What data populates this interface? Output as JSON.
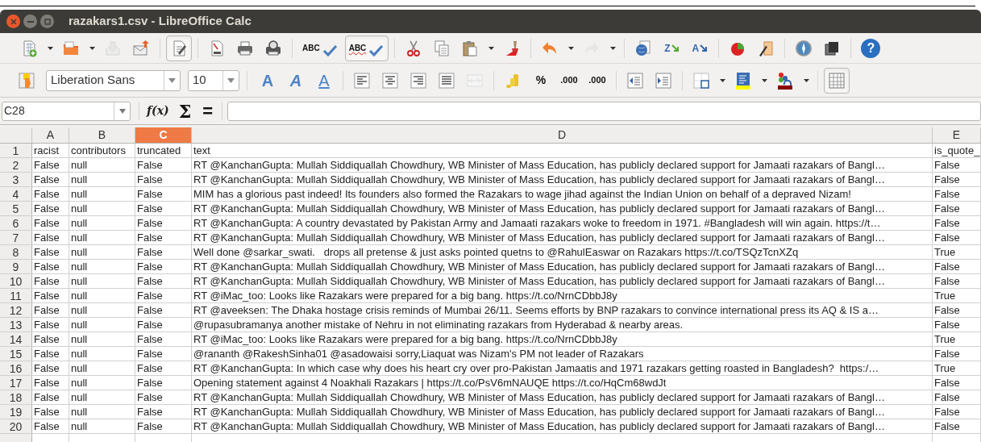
{
  "window": {
    "title": "razakars1.csv - LibreOffice Calc"
  },
  "standard_toolbar": [
    {
      "kind": "new",
      "dropdown": true,
      "pressed": false,
      "disabled": false
    },
    {
      "kind": "open",
      "dropdown": true,
      "pressed": false,
      "disabled": false
    },
    {
      "kind": "save",
      "dropdown": false,
      "pressed": false,
      "disabled": true
    },
    {
      "kind": "email",
      "dropdown": false,
      "pressed": false,
      "disabled": false
    },
    {
      "kind": "sep"
    },
    {
      "kind": "edit",
      "dropdown": false,
      "pressed": true,
      "disabled": false
    },
    {
      "kind": "sep"
    },
    {
      "kind": "pdf",
      "dropdown": false,
      "pressed": false,
      "disabled": false
    },
    {
      "kind": "print",
      "dropdown": false,
      "pressed": false,
      "disabled": false
    },
    {
      "kind": "preview",
      "dropdown": false,
      "pressed": false,
      "disabled": false
    },
    {
      "kind": "sep"
    },
    {
      "kind": "spell",
      "glyph": "ABC",
      "dropdown": false,
      "pressed": false,
      "disabled": false
    },
    {
      "kind": "autospell",
      "glyph": "ABC",
      "dropdown": false,
      "pressed": true,
      "disabled": false
    },
    {
      "kind": "sep"
    },
    {
      "kind": "cut",
      "dropdown": false,
      "pressed": false,
      "disabled": false
    },
    {
      "kind": "copy",
      "dropdown": false,
      "pressed": false,
      "disabled": false
    },
    {
      "kind": "paste",
      "dropdown": true,
      "pressed": false,
      "disabled": false
    },
    {
      "kind": "brush",
      "dropdown": false,
      "pressed": false,
      "disabled": false
    },
    {
      "kind": "sep"
    },
    {
      "kind": "undo",
      "dropdown": true,
      "pressed": false,
      "disabled": false
    },
    {
      "kind": "redo",
      "dropdown": true,
      "pressed": false,
      "disabled": true
    },
    {
      "kind": "sep"
    },
    {
      "kind": "globe",
      "dropdown": false,
      "pressed": false,
      "disabled": false
    },
    {
      "kind": "sort_asc",
      "glyph": "Z",
      "dropdown": false,
      "pressed": false,
      "disabled": false
    },
    {
      "kind": "sort_desc",
      "glyph": "A",
      "dropdown": false,
      "pressed": false,
      "disabled": false
    },
    {
      "kind": "sep"
    },
    {
      "kind": "chart",
      "dropdown": false,
      "pressed": false,
      "disabled": false
    },
    {
      "kind": "draw",
      "dropdown": false,
      "pressed": false,
      "disabled": false
    },
    {
      "kind": "sep"
    },
    {
      "kind": "compass",
      "dropdown": false,
      "pressed": false,
      "disabled": false
    },
    {
      "kind": "gallery",
      "dropdown": false,
      "pressed": false,
      "disabled": false
    },
    {
      "kind": "sep"
    },
    {
      "kind": "help",
      "glyph": "?",
      "dropdown": false,
      "pressed": false,
      "disabled": false
    }
  ],
  "formatting_toolbar": {
    "font_name": "Liberation Sans",
    "font_size": "10",
    "items": [
      {
        "kind": "bold",
        "glyph": "A",
        "dropdown": false,
        "pressed": false,
        "disabled": false
      },
      {
        "kind": "italic",
        "glyph": "A",
        "dropdown": false,
        "pressed": false,
        "disabled": false
      },
      {
        "kind": "underline",
        "glyph": "A",
        "dropdown": false,
        "pressed": false,
        "disabled": false
      },
      {
        "kind": "sep"
      },
      {
        "kind": "align_left",
        "dropdown": false,
        "pressed": false,
        "disabled": false
      },
      {
        "kind": "align_center",
        "dropdown": false,
        "pressed": false,
        "disabled": false
      },
      {
        "kind": "align_right",
        "dropdown": false,
        "pressed": false,
        "disabled": false
      },
      {
        "kind": "justify",
        "dropdown": false,
        "pressed": false,
        "disabled": false
      },
      {
        "kind": "merge",
        "dropdown": false,
        "pressed": false,
        "disabled": true
      },
      {
        "kind": "sep"
      },
      {
        "kind": "currency",
        "dropdown": false,
        "pressed": false,
        "disabled": false
      },
      {
        "kind": "percent",
        "glyph": "%",
        "dropdown": false,
        "pressed": false,
        "disabled": false
      },
      {
        "kind": "add_decimal",
        "glyph": ".000",
        "dropdown": false,
        "pressed": false,
        "disabled": false
      },
      {
        "kind": "delete_decimal",
        "glyph": ".000",
        "dropdown": false,
        "pressed": false,
        "disabled": false
      },
      {
        "kind": "sep"
      },
      {
        "kind": "indent_less",
        "dropdown": false,
        "pressed": false,
        "disabled": false
      },
      {
        "kind": "indent_more",
        "dropdown": false,
        "pressed": false,
        "disabled": false
      },
      {
        "kind": "sep"
      },
      {
        "kind": "borders",
        "dropdown": true,
        "pressed": false,
        "disabled": false
      },
      {
        "kind": "background",
        "dropdown": true,
        "pressed": false,
        "disabled": false
      },
      {
        "kind": "font_color",
        "dropdown": true,
        "pressed": false,
        "disabled": false
      },
      {
        "kind": "sep"
      },
      {
        "kind": "grid",
        "dropdown": false,
        "pressed": true,
        "disabled": false
      }
    ]
  },
  "formula_bar": {
    "cell_reference": "C28",
    "function_wizard": "f(x)",
    "sum": "Σ",
    "equals": "="
  },
  "sheet": {
    "columns": [
      {
        "label": "A",
        "selected": false
      },
      {
        "label": "B",
        "selected": false
      },
      {
        "label": "C",
        "selected": true
      },
      {
        "label": "D",
        "selected": false
      },
      {
        "label": "E",
        "selected": false
      }
    ],
    "rows": [
      {
        "number": "1",
        "cells": [
          "racist",
          "contributors",
          "truncated",
          "text",
          "is_quote_"
        ]
      },
      {
        "number": "2",
        "cells": [
          "False",
          "null",
          "False",
          "RT @KanchanGupta: Mullah Siddiquallah Chowdhury, WB Minister of Mass Education, has publicly declared support for Jamaati razakars of Bangl…",
          "False"
        ]
      },
      {
        "number": "3",
        "cells": [
          "False",
          "null",
          "False",
          "RT @KanchanGupta: Mullah Siddiquallah Chowdhury, WB Minister of Mass Education, has publicly declared support for Jamaati razakars of Bangl…",
          "False"
        ]
      },
      {
        "number": "4",
        "cells": [
          "False",
          "null",
          "False",
          "MIM has a glorious past indeed! Its founders also formed the Razakars to wage jihad against the Indian Union on behalf of a depraved Nizam!",
          "False"
        ]
      },
      {
        "number": "5",
        "cells": [
          "False",
          "null",
          "False",
          "RT @KanchanGupta: Mullah Siddiquallah Chowdhury, WB Minister of Mass Education, has publicly declared support for Jamaati razakars of Bangl…",
          "False"
        ]
      },
      {
        "number": "6",
        "cells": [
          "False",
          "null",
          "False",
          "RT @KanchanGupta: A country devastated by Pakistan Army and Jamaati razakars woke to freedom in 1971. #Bangladesh will win again. https://t…",
          "False"
        ]
      },
      {
        "number": "7",
        "cells": [
          "False",
          "null",
          "False",
          "RT @KanchanGupta: Mullah Siddiquallah Chowdhury, WB Minister of Mass Education, has publicly declared support for Jamaati razakars of Bangl…",
          "False"
        ]
      },
      {
        "number": "8",
        "cells": [
          "False",
          "null",
          "False",
          "Well done @sarkar_swati.   drops all pretense & just asks pointed quetns to @RahulEaswar on Razakars https://t.co/TSQzTcnXZq",
          "True"
        ]
      },
      {
        "number": "9",
        "cells": [
          "False",
          "null",
          "False",
          "RT @KanchanGupta: Mullah Siddiquallah Chowdhury, WB Minister of Mass Education, has publicly declared support for Jamaati razakars of Bangl…",
          "False"
        ]
      },
      {
        "number": "10",
        "cells": [
          "False",
          "null",
          "False",
          "RT @KanchanGupta: Mullah Siddiquallah Chowdhury, WB Minister of Mass Education, has publicly declared support for Jamaati razakars of Bangl…",
          "False"
        ]
      },
      {
        "number": "11",
        "cells": [
          "False",
          "null",
          "False",
          "RT @iMac_too: Looks like Razakars were prepared for a big bang. https://t.co/NrnCDbbJ8y",
          "True"
        ]
      },
      {
        "number": "12",
        "cells": [
          "False",
          "null",
          "False",
          "RT @aveeksen: The Dhaka hostage crisis reminds of Mumbai 26/11. Seems efforts by BNP razakars to convince international press its AQ & IS a…",
          "False"
        ]
      },
      {
        "number": "13",
        "cells": [
          "False",
          "null",
          "False",
          "@rupasubramanya another mistake of Nehru in not eliminating razakars from Hyderabad & nearby areas.",
          "False"
        ]
      },
      {
        "number": "14",
        "cells": [
          "False",
          "null",
          "False",
          "RT @iMac_too: Looks like Razakars were prepared for a big bang. https://t.co/NrnCDbbJ8y",
          "True"
        ]
      },
      {
        "number": "15",
        "cells": [
          "False",
          "null",
          "False",
          "@rananth @RakeshSinha01 @asadowaisi sorry,Liaquat was Nizam's PM not leader of Razakars",
          "False"
        ]
      },
      {
        "number": "16",
        "cells": [
          "False",
          "null",
          "False",
          "RT @KanchanGupta: In which case why does his heart cry over pro-Pakistan Jamaatis and 1971 razakars getting roasted in Bangladesh?  https:/…",
          "True"
        ]
      },
      {
        "number": "17",
        "cells": [
          "False",
          "null",
          "False",
          "Opening statement against 4 Noakhali Razakars | https://t.co/PsV6mNAUQE https://t.co/HqCm68wdJt",
          "False"
        ]
      },
      {
        "number": "18",
        "cells": [
          "False",
          "null",
          "False",
          "RT @KanchanGupta: Mullah Siddiquallah Chowdhury, WB Minister of Mass Education, has publicly declared support for Jamaati razakars of Bangl…",
          "False"
        ]
      },
      {
        "number": "19",
        "cells": [
          "False",
          "null",
          "False",
          "RT @KanchanGupta: Mullah Siddiquallah Chowdhury, WB Minister of Mass Education, has publicly declared support for Jamaati razakars of Bangl…",
          "False"
        ]
      },
      {
        "number": "20",
        "cells": [
          "False",
          "null",
          "False",
          "RT @KanchanGupta: Mullah Siddiquallah Chowdhury, WB Minister of Mass Education, has publicly declared support for Jamaati razakars of Bangl…",
          "False"
        ]
      }
    ]
  }
}
